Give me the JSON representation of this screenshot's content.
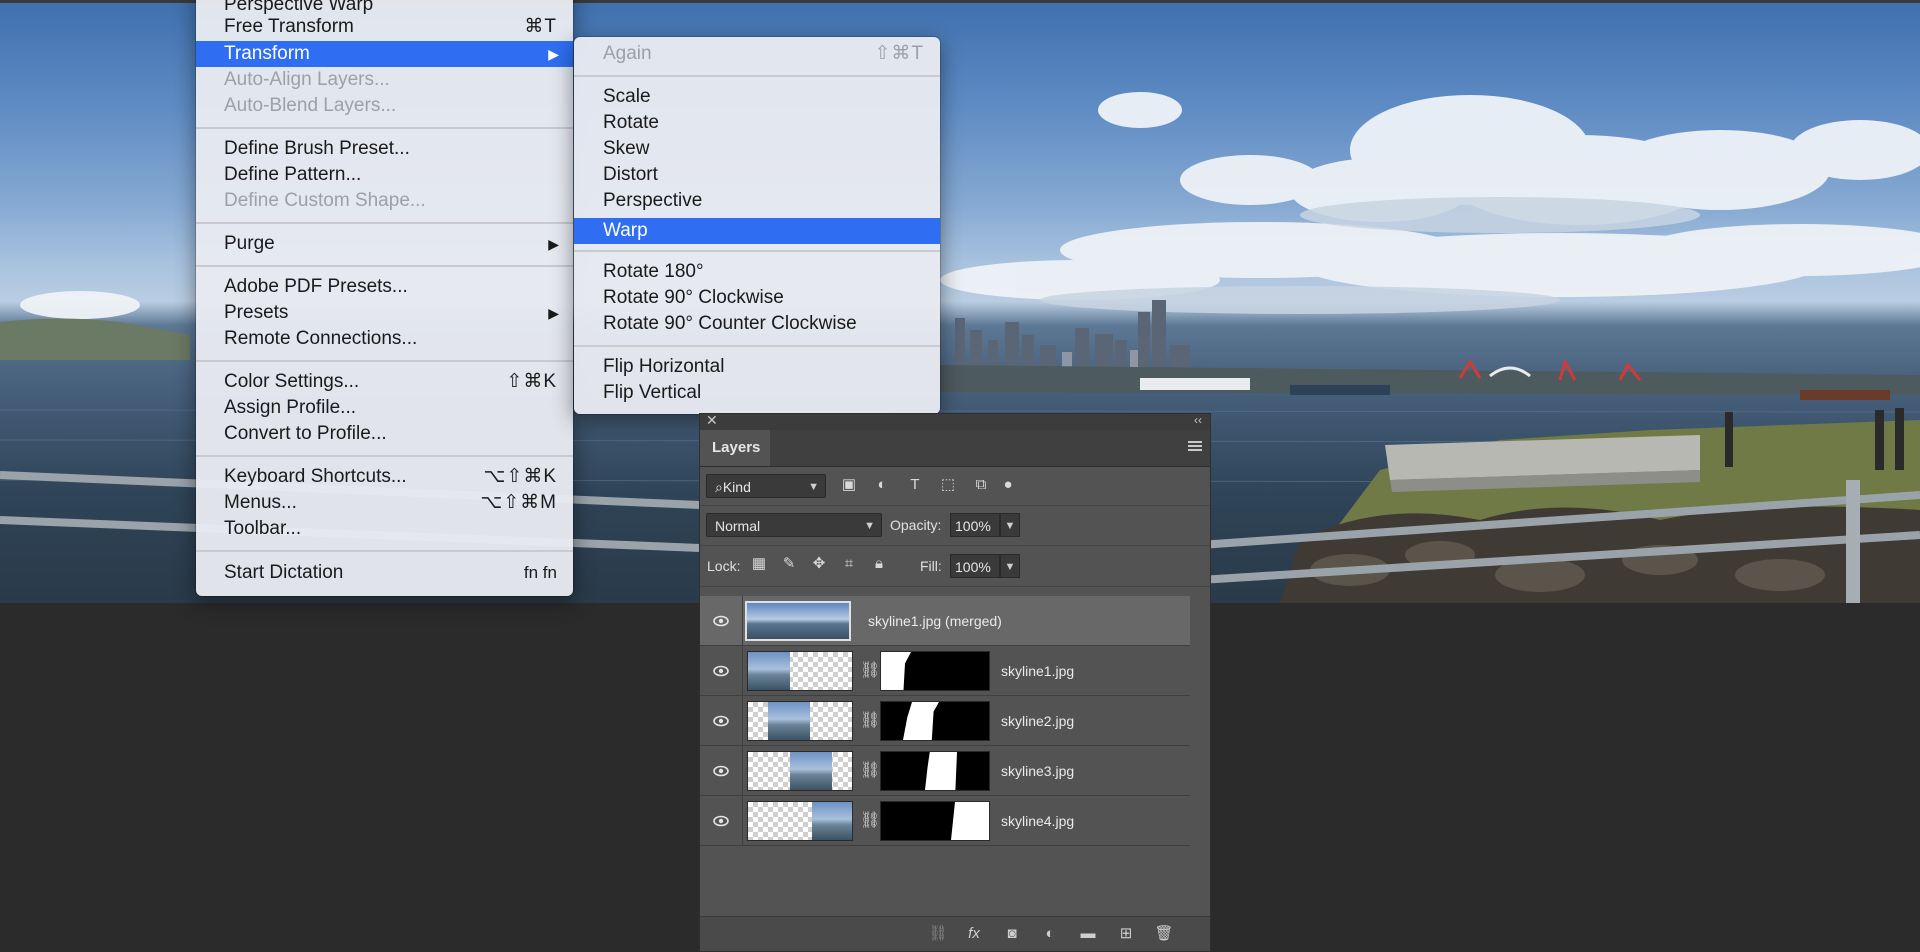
{
  "edit_menu": {
    "items": [
      {
        "label": "Perspective Warp",
        "shortcut": "",
        "state": "normal"
      },
      {
        "label": "Free Transform",
        "shortcut": "⌘T",
        "state": "normal"
      },
      {
        "label": "Transform",
        "shortcut": "",
        "state": "highlighted",
        "submenu": true
      },
      {
        "label": "Auto-Align Layers...",
        "shortcut": "",
        "state": "disabled"
      },
      {
        "label": "Auto-Blend Layers...",
        "shortcut": "",
        "state": "disabled"
      },
      {
        "label": "Define Brush Preset...",
        "shortcut": "",
        "state": "normal"
      },
      {
        "label": "Define Pattern...",
        "shortcut": "",
        "state": "normal"
      },
      {
        "label": "Define Custom Shape...",
        "shortcut": "",
        "state": "disabled"
      },
      {
        "label": "Purge",
        "shortcut": "",
        "state": "normal",
        "submenu": true
      },
      {
        "label": "Adobe PDF Presets...",
        "shortcut": "",
        "state": "normal"
      },
      {
        "label": "Presets",
        "shortcut": "",
        "state": "normal",
        "submenu": true
      },
      {
        "label": "Remote Connections...",
        "shortcut": "",
        "state": "normal"
      },
      {
        "label": "Color Settings...",
        "shortcut": "⇧⌘K",
        "state": "normal"
      },
      {
        "label": "Assign Profile...",
        "shortcut": "",
        "state": "normal"
      },
      {
        "label": "Convert to Profile...",
        "shortcut": "",
        "state": "normal"
      },
      {
        "label": "Keyboard Shortcuts...",
        "shortcut": "⌥⇧⌘K",
        "state": "normal"
      },
      {
        "label": "Menus...",
        "shortcut": "⌥⇧⌘M",
        "state": "normal"
      },
      {
        "label": "Toolbar...",
        "shortcut": "",
        "state": "normal"
      },
      {
        "label": "Start Dictation",
        "shortcut": "fn fn",
        "state": "normal"
      }
    ]
  },
  "transform_menu": {
    "items": [
      {
        "label": "Again",
        "shortcut": "⇧⌘T",
        "state": "disabled"
      },
      {
        "label": "Scale",
        "shortcut": "",
        "state": "normal"
      },
      {
        "label": "Rotate",
        "shortcut": "",
        "state": "normal"
      },
      {
        "label": "Skew",
        "shortcut": "",
        "state": "normal"
      },
      {
        "label": "Distort",
        "shortcut": "",
        "state": "normal"
      },
      {
        "label": "Perspective",
        "shortcut": "",
        "state": "normal"
      },
      {
        "label": "Warp",
        "shortcut": "",
        "state": "highlighted"
      },
      {
        "label": "Rotate 180°",
        "shortcut": "",
        "state": "normal"
      },
      {
        "label": "Rotate 90° Clockwise",
        "shortcut": "",
        "state": "normal"
      },
      {
        "label": "Rotate 90° Counter Clockwise",
        "shortcut": "",
        "state": "normal"
      },
      {
        "label": "Flip Horizontal",
        "shortcut": "",
        "state": "normal"
      },
      {
        "label": "Flip Vertical",
        "shortcut": "",
        "state": "normal"
      }
    ]
  },
  "layers_panel": {
    "tab_label": "Layers",
    "filter_kind": "Kind",
    "blend_mode": "Normal",
    "opacity_label": "Opacity:",
    "opacity_value": "100%",
    "lock_label": "Lock:",
    "fill_label": "Fill:",
    "fill_value": "100%",
    "layers": [
      {
        "name": "skyline1.jpg (merged)",
        "visible": true,
        "selected": true,
        "has_mask": false
      },
      {
        "name": "skyline1.jpg",
        "visible": true,
        "selected": false,
        "has_mask": true
      },
      {
        "name": "skyline2.jpg",
        "visible": true,
        "selected": false,
        "has_mask": true
      },
      {
        "name": "skyline3.jpg",
        "visible": true,
        "selected": false,
        "has_mask": true
      },
      {
        "name": "skyline4.jpg",
        "visible": true,
        "selected": false,
        "has_mask": true
      }
    ]
  },
  "colors": {
    "menu_highlight": "#2f6ef2",
    "panel_bg": "#535353",
    "workspace_bg": "#2b2b2b"
  }
}
